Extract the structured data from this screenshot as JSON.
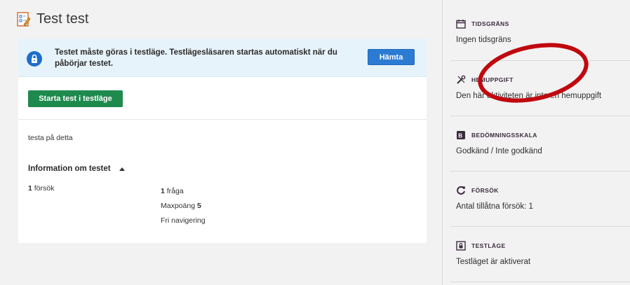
{
  "page": {
    "title": "Test test"
  },
  "notice": {
    "text": "Testet måste göras i testläge. Testlägesläsaren startas automatiskt när du påbörjar testet.",
    "button": "Hämta"
  },
  "main": {
    "start_button": "Starta test i testläge",
    "description": "testa på detta",
    "info_title": "Information om testet",
    "attempts_num": "1",
    "attempts_label": "försök",
    "questions_num": "1",
    "questions_label": "fråga",
    "maxpoints_label": "Maxpoäng",
    "maxpoints_value": "5",
    "navigation": "Fri navigering"
  },
  "sidebar": {
    "sections": [
      {
        "label": "TIDSGRÄNS",
        "value": "Ingen tidsgräns",
        "icon": "calendar-icon"
      },
      {
        "label": "HEMUPPGIFT",
        "value": "Den här aktiviteten är inte en hemuppgift",
        "icon": "tools-icon"
      },
      {
        "label": "BEDÖMNINGSSKALA",
        "value": "Godkänd / Inte godkänd",
        "icon": "grade-icon"
      },
      {
        "label": "FÖRSÖK",
        "value": "Antal tillåtna försök: 1",
        "icon": "retry-icon"
      },
      {
        "label": "TESTLÄGE",
        "value": "Testläget är aktiverat",
        "icon": "lockdown-icon"
      }
    ]
  },
  "colors": {
    "notice_bg": "#e7f3fa",
    "primary_button": "#2b7bd3",
    "start_button": "#1f8a4e",
    "sidebar_label": "#3b2a3e",
    "annotation": "#c0080f"
  }
}
